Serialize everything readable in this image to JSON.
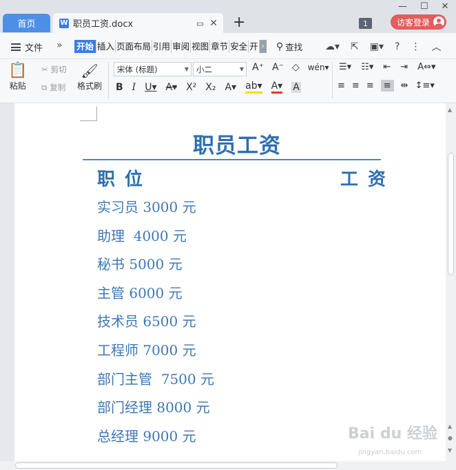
{
  "titlebar": {
    "home_tab": "首页",
    "doc_tab": "职员工资.docx",
    "doc_icon": "W",
    "tab_count": "1",
    "login": "访客登录"
  },
  "menu": {
    "file": "文件",
    "more": "»",
    "tabs": [
      "开始",
      "插入",
      "页面布局",
      "引用",
      "审阅",
      "视图",
      "章节",
      "安全",
      "开"
    ],
    "active_tab": "开始",
    "search": "查找"
  },
  "ribbon": {
    "paste": "粘贴",
    "cut": "剪切",
    "copy": "复制",
    "format_painter": "格式刷",
    "font_name": "宋体 (标题)",
    "font_size": "小二"
  },
  "document": {
    "title": "职员工资",
    "col_position": "职位",
    "col_salary": "工资",
    "rows": [
      "实习员 3000 元",
      "助理  4000 元",
      "秘书 5000 元",
      "主管 6000 元",
      "技术员 6500 元",
      "工程师 7000 元",
      "部门主管  7500 元",
      "部门经理 8000 元",
      "总经理 9000 元"
    ]
  },
  "watermark": {
    "brand": "Bai du 经验",
    "url": "jingyan.baidu.com"
  },
  "colors": {
    "accent": "#3b7be6",
    "doc_text": "#2e6fb0",
    "login_bg": "#e35d5d"
  }
}
